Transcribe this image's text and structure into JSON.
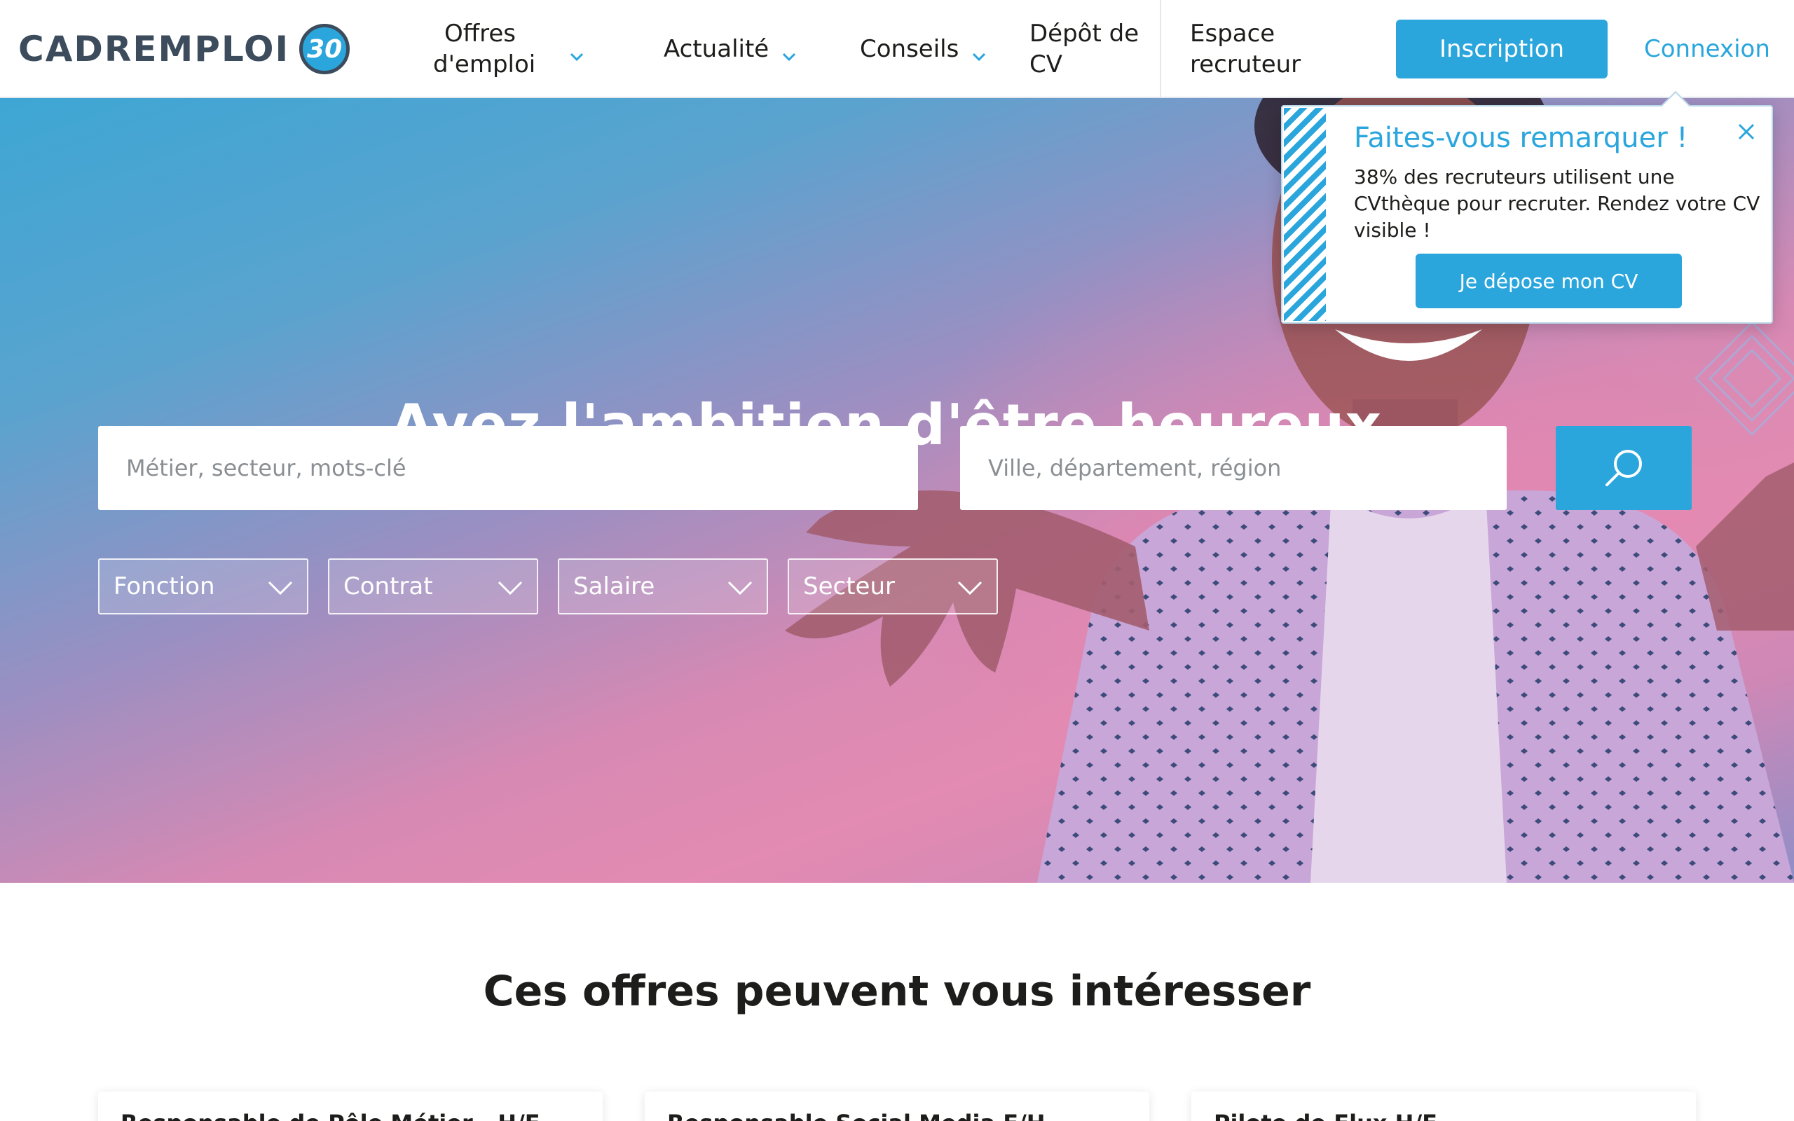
{
  "header": {
    "logo_text": "CADREMPLOI",
    "logo_badge": "30",
    "nav": [
      {
        "label": "Offres d'emploi",
        "has_dropdown": true
      },
      {
        "label": "Actualité",
        "has_dropdown": true
      },
      {
        "label": "Conseils",
        "has_dropdown": true
      },
      {
        "label": "Dépôt de CV",
        "has_dropdown": false
      },
      {
        "label": "Espace recruteur",
        "has_dropdown": false
      }
    ],
    "signup_label": "Inscription",
    "login_label": "Connexion"
  },
  "hero": {
    "title": "Ayez l'ambition d'être heureux.",
    "search": {
      "keywords_placeholder": "Métier, secteur, mots-clé",
      "location_placeholder": "Ville, département, région",
      "submit_icon": "search-icon"
    },
    "filters": [
      {
        "label": "Fonction"
      },
      {
        "label": "Contrat"
      },
      {
        "label": "Salaire"
      },
      {
        "label": "Secteur"
      }
    ]
  },
  "popup": {
    "title": "Faites-vous remarquer !",
    "text": "38% des recruteurs utilisent une CVthèque pour recruter. Rendez votre CV visible !",
    "button_label": "Je dépose mon CV",
    "close_icon": "close-icon"
  },
  "offers": {
    "title": "Ces offres peuvent vous intéresser",
    "cards": [
      {
        "title": "Responsable de Pôle Métier - H/F"
      },
      {
        "title": "Responsable Social Media F/H"
      },
      {
        "title": "Pilote de Flux H/F"
      }
    ]
  },
  "colors": {
    "brand_blue": "#2aa6dd",
    "logo_dark": "#3d4c5c",
    "hero_blue": "#3ea6d4",
    "hero_pink": "#e38bb2"
  }
}
